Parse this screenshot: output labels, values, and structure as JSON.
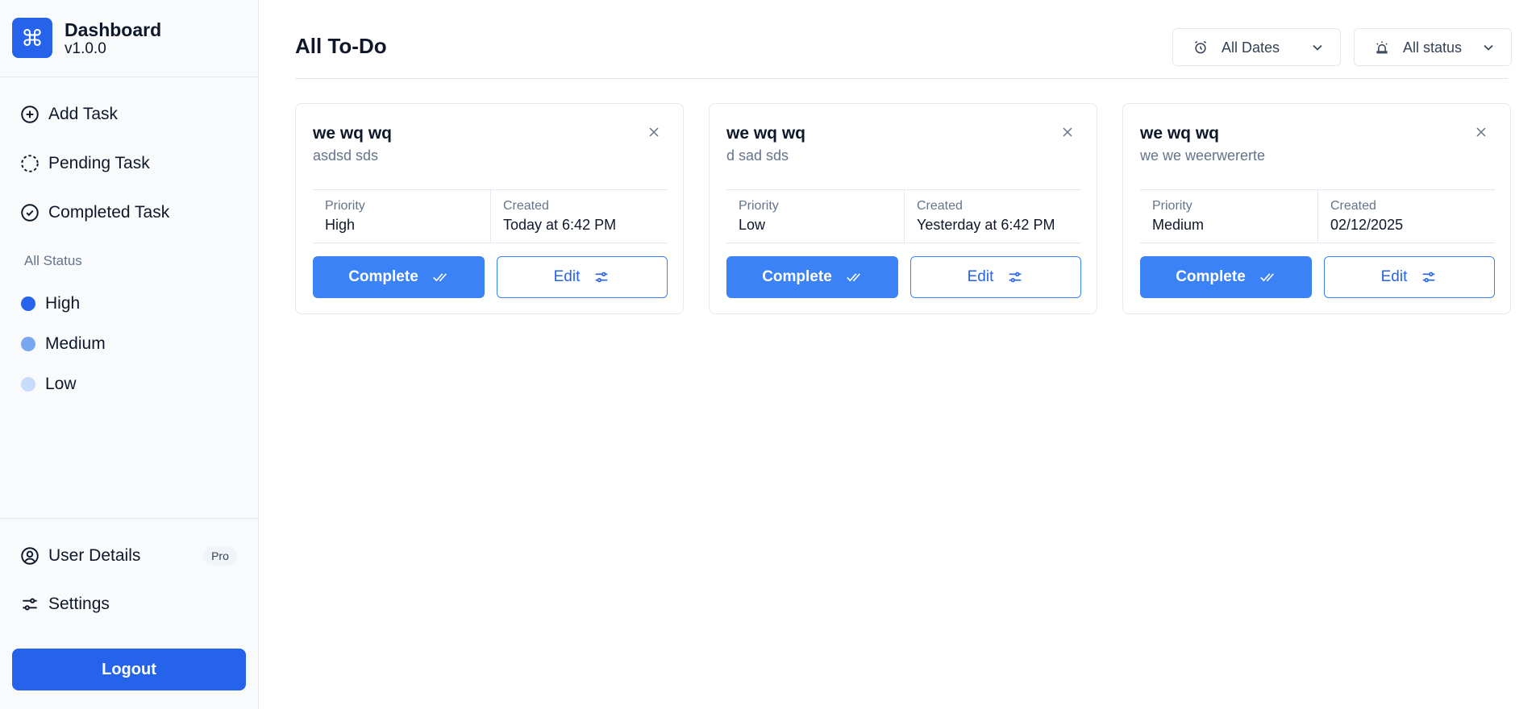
{
  "brand": {
    "title": "Dashboard",
    "version": "v1.0.0",
    "logo_glyph": "⌘"
  },
  "sidebar": {
    "nav": [
      {
        "label": "Add Task",
        "icon": "plus-circle-icon"
      },
      {
        "label": "Pending Task",
        "icon": "dashed-circle-icon"
      },
      {
        "label": "Completed Task",
        "icon": "check-circle-icon"
      }
    ],
    "status_heading": "All Status",
    "priorities": [
      {
        "label": "High",
        "color": "#2563eb"
      },
      {
        "label": "Medium",
        "color": "#7aa8f0"
      },
      {
        "label": "Low",
        "color": "#c7dcfb"
      }
    ],
    "user_details_label": "User Details",
    "pro_badge": "Pro",
    "settings_label": "Settings",
    "logout_label": "Logout"
  },
  "main": {
    "title": "All To-Do",
    "filters": {
      "dates": "All Dates",
      "status": "All status"
    },
    "card_labels": {
      "priority": "Priority",
      "created": "Created",
      "complete": "Complete",
      "edit": "Edit"
    },
    "tasks": [
      {
        "title": "we wq wq",
        "description": "asdsd sds",
        "priority": "High",
        "created": "Today at 6:42 PM"
      },
      {
        "title": "we wq wq",
        "description": "d sad sds",
        "priority": "Low",
        "created": "Yesterday at 6:42 PM"
      },
      {
        "title": "we wq wq",
        "description": "we we weerwererte",
        "priority": "Medium",
        "created": "02/12/2025"
      }
    ]
  },
  "colors": {
    "accent": "#2563eb",
    "button": "#3b82f6",
    "border": "#e2e8f0",
    "muted_text": "#64748b"
  }
}
